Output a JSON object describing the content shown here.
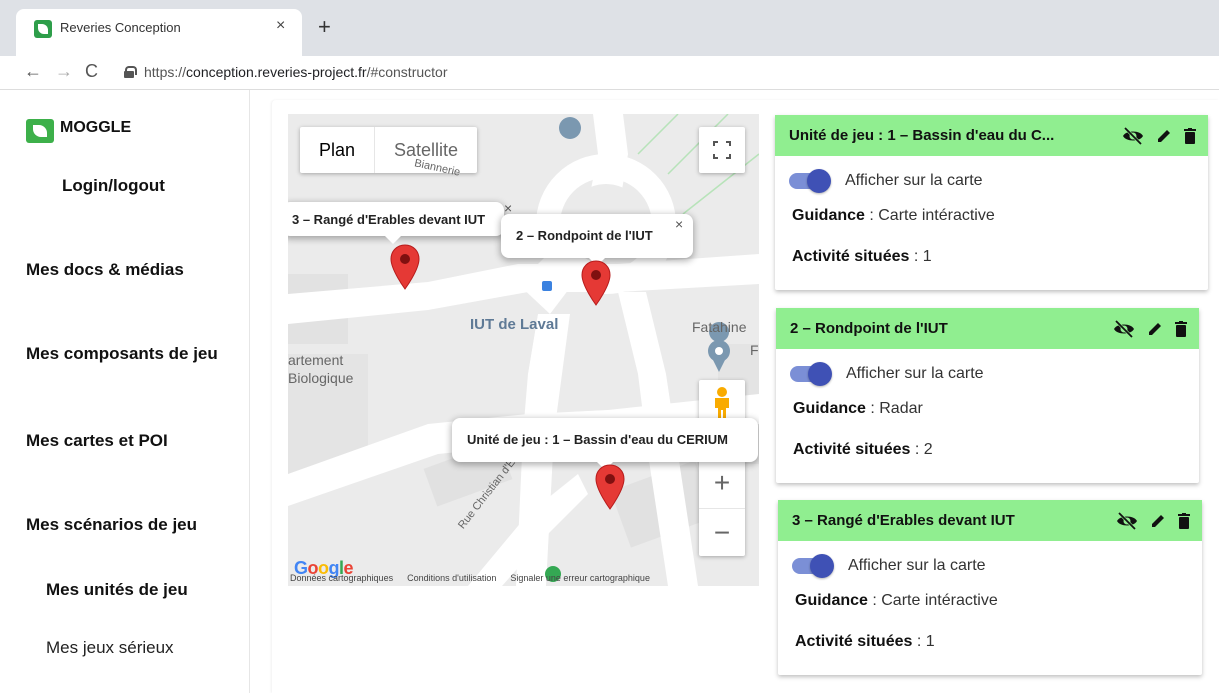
{
  "browser": {
    "tab_title": "Reveries Conception",
    "tab_close": "×",
    "new_tab": "+",
    "back": "←",
    "forward": "→",
    "reload": "C",
    "url_prefix": "https://",
    "url_host": "conception.reveries-project.fr",
    "url_path": "/#constructor"
  },
  "sidebar": {
    "brand": "MOGGLE",
    "login": "Login/logout",
    "docs": "Mes docs & médias",
    "components": "Mes composants de jeu",
    "maps": "Mes cartes et POI",
    "scenarios": "Mes scénarios de jeu",
    "units": "Mes unités de jeu",
    "serious_games": "Mes jeux sérieux"
  },
  "map": {
    "type_plan": "Plan",
    "type_satellite": "Satellite",
    "zoom_in": "+",
    "zoom_out": "−",
    "label_iut": "IUT de Laval",
    "label_fatahine": "Fatahine",
    "label_f": "F",
    "label_dept_1": "artement",
    "label_dept_2": "Biologique",
    "label_street_1": "Rue Christian d'Elva",
    "label_street_2": "Biannerie",
    "infowindow_1": "3 – Rangé d'Erables devant IUT",
    "infowindow_2": "2 – Rondpoint de l'IUT",
    "infowindow_3": "Unité de jeu : 1 – Bassin d'eau du CERIUM",
    "close": "×",
    "google": "Google",
    "footer_data": "Données cartographiques",
    "footer_terms": "Conditions d'utilisation",
    "footer_report": "Signaler une erreur cartographique"
  },
  "cards": [
    {
      "title": "Unité de jeu : 1 – Bassin d'eau du C...",
      "toggle_label": "Afficher sur la carte",
      "guidance_label": "Guidance",
      "guidance_value": " : Carte intéractive",
      "activity_label": "Activité situées",
      "activity_value": " : 1"
    },
    {
      "title": "2 – Rondpoint de l'IUT",
      "toggle_label": "Afficher sur la carte",
      "guidance_label": "Guidance",
      "guidance_value": " : Radar",
      "activity_label": "Activité situées",
      "activity_value": " : 2"
    },
    {
      "title": "3 – Rangé d'Erables devant IUT",
      "toggle_label": "Afficher sur la carte",
      "guidance_label": "Guidance",
      "guidance_value": " : Carte intéractive",
      "activity_label": "Activité situées",
      "activity_value": " : 1"
    }
  ],
  "colors": {
    "card_header": "#90ee90",
    "toggle": "#3f51b5",
    "marker": "#e53935"
  }
}
